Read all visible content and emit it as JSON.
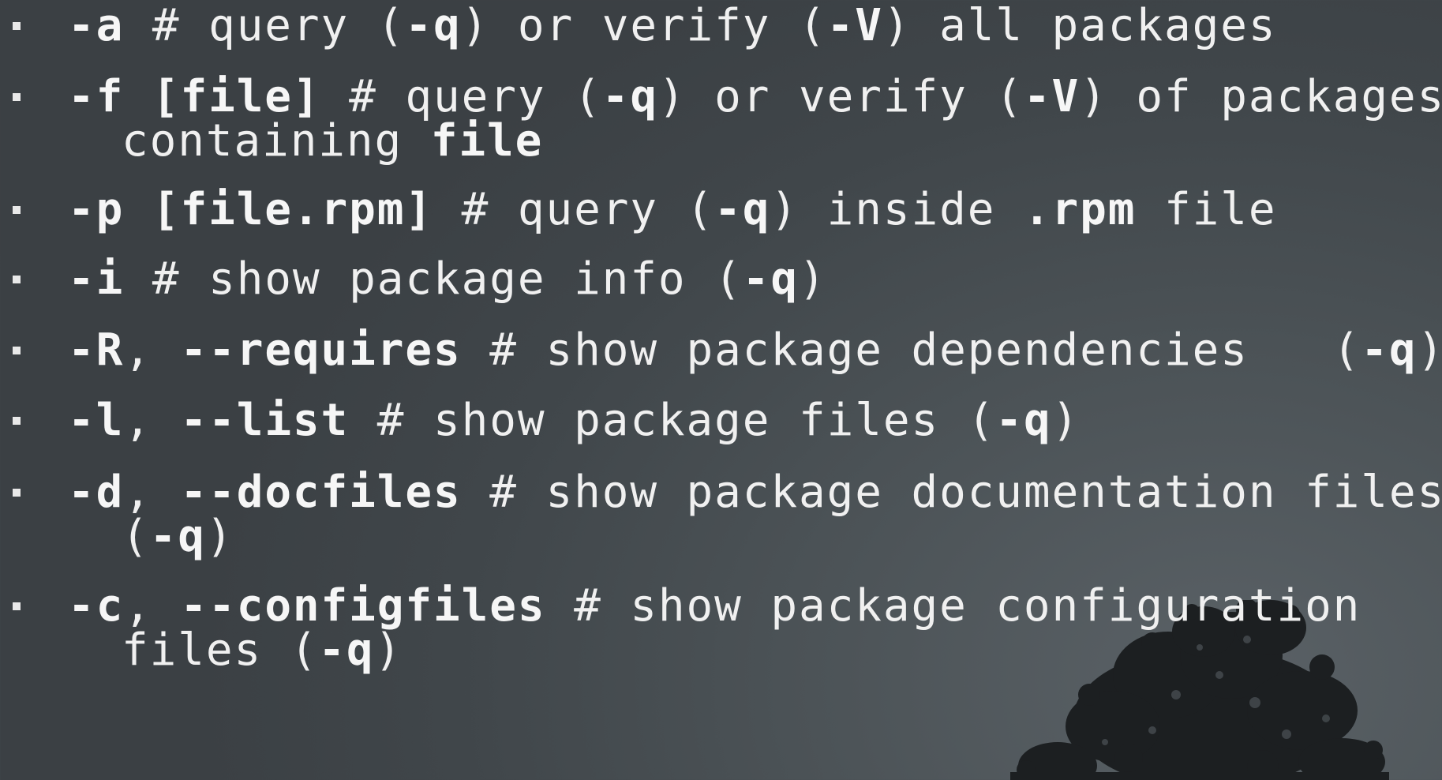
{
  "background": {
    "accent": "#4c5357",
    "dark": "#3b4044",
    "text_color": "#f0f0f0"
  },
  "items": [
    {
      "lines": [
        [
          {
            "t": "-a",
            "b": true
          },
          {
            "t": " # query (",
            "b": false
          },
          {
            "t": "-q",
            "b": true
          },
          {
            "t": ") or verify (",
            "b": false
          },
          {
            "t": "-V",
            "b": true
          },
          {
            "t": ") all packages",
            "b": false
          }
        ]
      ]
    },
    {
      "lines": [
        [
          {
            "t": "-f [file]",
            "b": true
          },
          {
            "t": " # query (",
            "b": false
          },
          {
            "t": "-q",
            "b": true
          },
          {
            "t": ") or verify (",
            "b": false
          },
          {
            "t": "-V",
            "b": true
          },
          {
            "t": ") of packages",
            "b": false
          }
        ],
        [
          {
            "t": "containing ",
            "b": false
          },
          {
            "t": "file",
            "b": true
          }
        ]
      ]
    },
    {
      "lines": [
        [
          {
            "t": "-p [file.rpm]",
            "b": true
          },
          {
            "t": " # query (",
            "b": false
          },
          {
            "t": "-q",
            "b": true
          },
          {
            "t": ") inside ",
            "b": false
          },
          {
            "t": ".rpm",
            "b": true
          },
          {
            "t": " file",
            "b": false
          }
        ]
      ]
    },
    {
      "lines": [
        [
          {
            "t": "-i",
            "b": true
          },
          {
            "t": " # show package info (",
            "b": false
          },
          {
            "t": "-q",
            "b": true
          },
          {
            "t": ")",
            "b": false
          }
        ]
      ]
    },
    {
      "lines": [
        [
          {
            "t": "-R",
            "b": true
          },
          {
            "t": ", ",
            "b": false
          },
          {
            "t": "--requires",
            "b": true
          },
          {
            "t": " # show package dependencies   (",
            "b": false
          },
          {
            "t": "-q",
            "b": true
          },
          {
            "t": ")",
            "b": false
          }
        ]
      ]
    },
    {
      "lines": [
        [
          {
            "t": "-l",
            "b": true
          },
          {
            "t": ", ",
            "b": false
          },
          {
            "t": "--list",
            "b": true
          },
          {
            "t": " # show package files (",
            "b": false
          },
          {
            "t": "-q",
            "b": true
          },
          {
            "t": ")",
            "b": false
          }
        ]
      ]
    },
    {
      "lines": [
        [
          {
            "t": "-d",
            "b": true
          },
          {
            "t": ", ",
            "b": false
          },
          {
            "t": "--docfiles",
            "b": true
          },
          {
            "t": " # show package documentation files",
            "b": false
          }
        ],
        [
          {
            "t": "(",
            "b": false
          },
          {
            "t": "-q",
            "b": true
          },
          {
            "t": ")",
            "b": false
          }
        ]
      ]
    },
    {
      "lines": [
        [
          {
            "t": "-c",
            "b": true
          },
          {
            "t": ", ",
            "b": false
          },
          {
            "t": "--configfiles",
            "b": true
          },
          {
            "t": " # show package configuration",
            "b": false
          }
        ],
        [
          {
            "t": "files (",
            "b": false
          },
          {
            "t": "-q",
            "b": true
          },
          {
            "t": ")",
            "b": false
          }
        ]
      ]
    }
  ]
}
